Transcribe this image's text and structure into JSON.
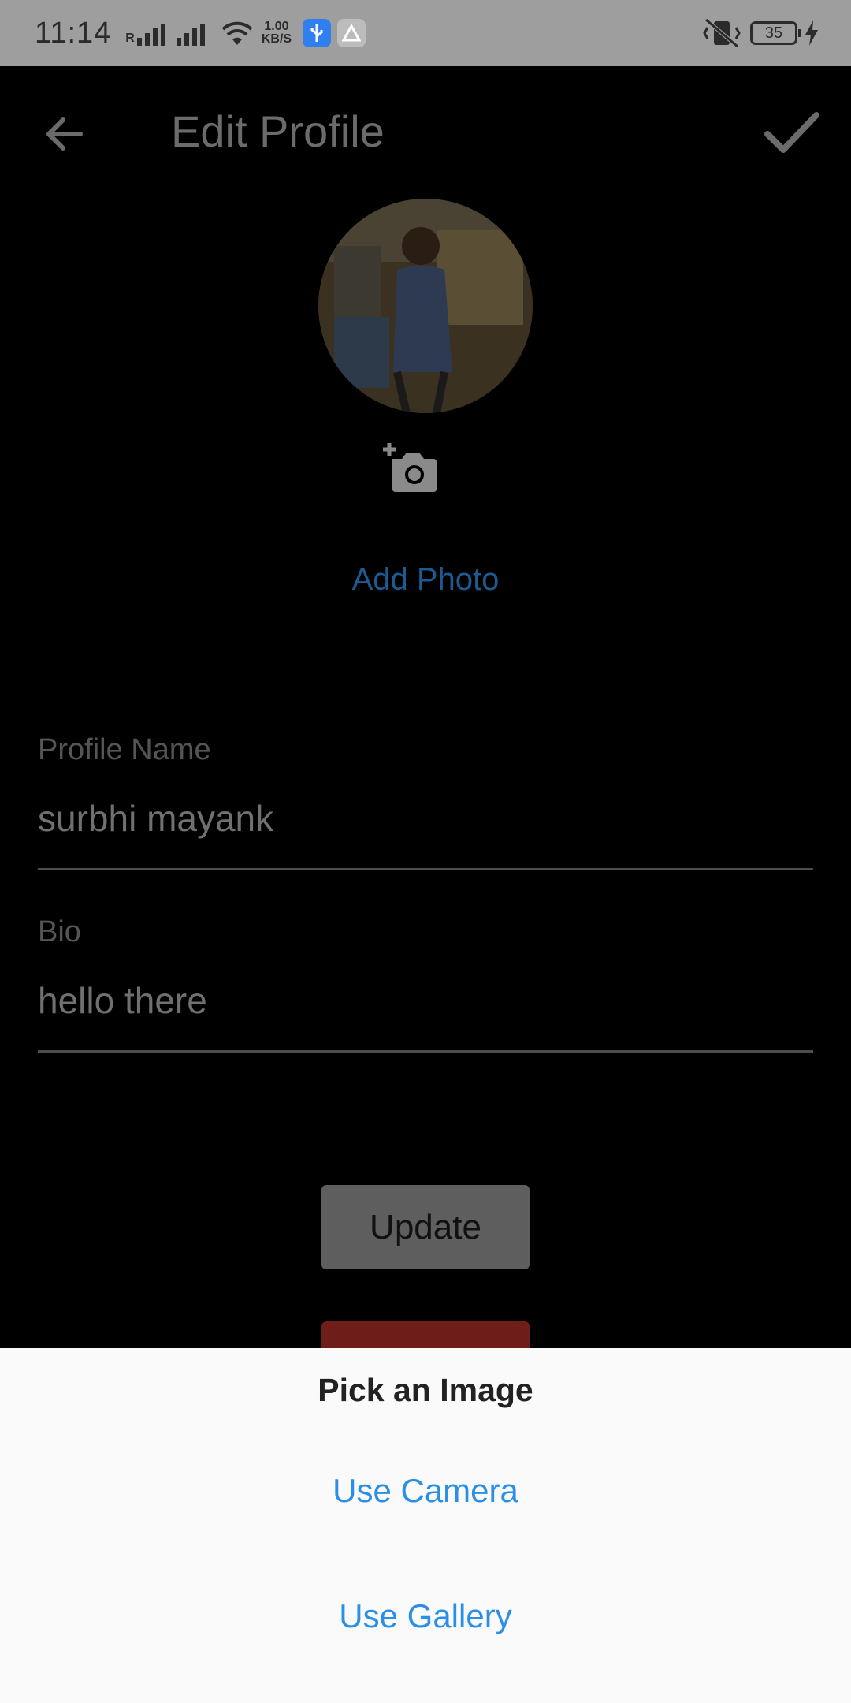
{
  "status_bar": {
    "time": "11:14",
    "net_speed_value": "1.00",
    "net_speed_unit": "KB/S",
    "battery_level": "35"
  },
  "app_bar": {
    "title": "Edit Profile",
    "back_icon": "arrow-left-icon",
    "confirm_icon": "check-icon"
  },
  "profile": {
    "add_photo_label": "Add Photo",
    "camera_icon": "add-camera-icon"
  },
  "fields": {
    "profile_name": {
      "label": "Profile Name",
      "value": "surbhi mayank"
    },
    "bio": {
      "label": "Bio",
      "value": "hello there"
    }
  },
  "buttons": {
    "update_label": "Update"
  },
  "sheet": {
    "title": "Pick an Image",
    "options": [
      "Use Camera",
      "Use Gallery"
    ]
  },
  "colors": {
    "accent": "#2c8fe6",
    "sheet_bg": "#fafafa",
    "overlay_bg": "#000000"
  }
}
